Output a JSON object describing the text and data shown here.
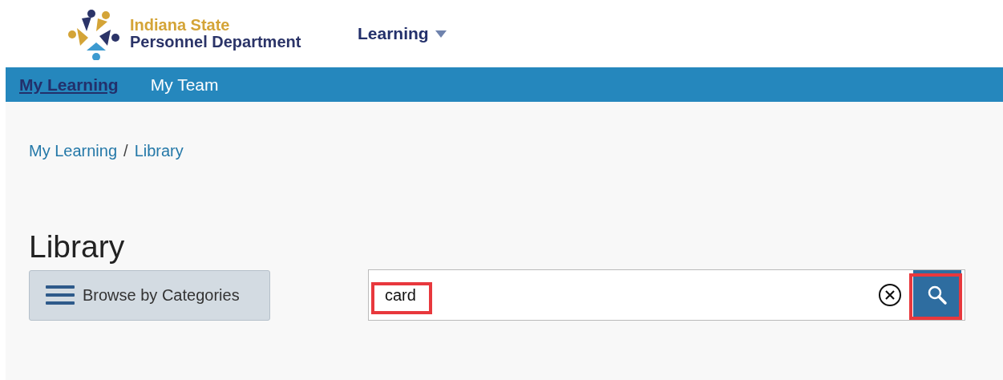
{
  "header": {
    "org_line_1": "Indiana State",
    "org_line_2": "Personnel Department",
    "menu": "Learning"
  },
  "nav": [
    {
      "label": "My Learning",
      "selected": true
    },
    {
      "label": "My Team",
      "selected": false
    }
  ],
  "breadcrumb": [
    "My Learning",
    "Library"
  ],
  "breadcrumb_separator": "/",
  "page_title": "Library",
  "browse_button": "Browse by Categories",
  "search": {
    "value": "card"
  }
}
